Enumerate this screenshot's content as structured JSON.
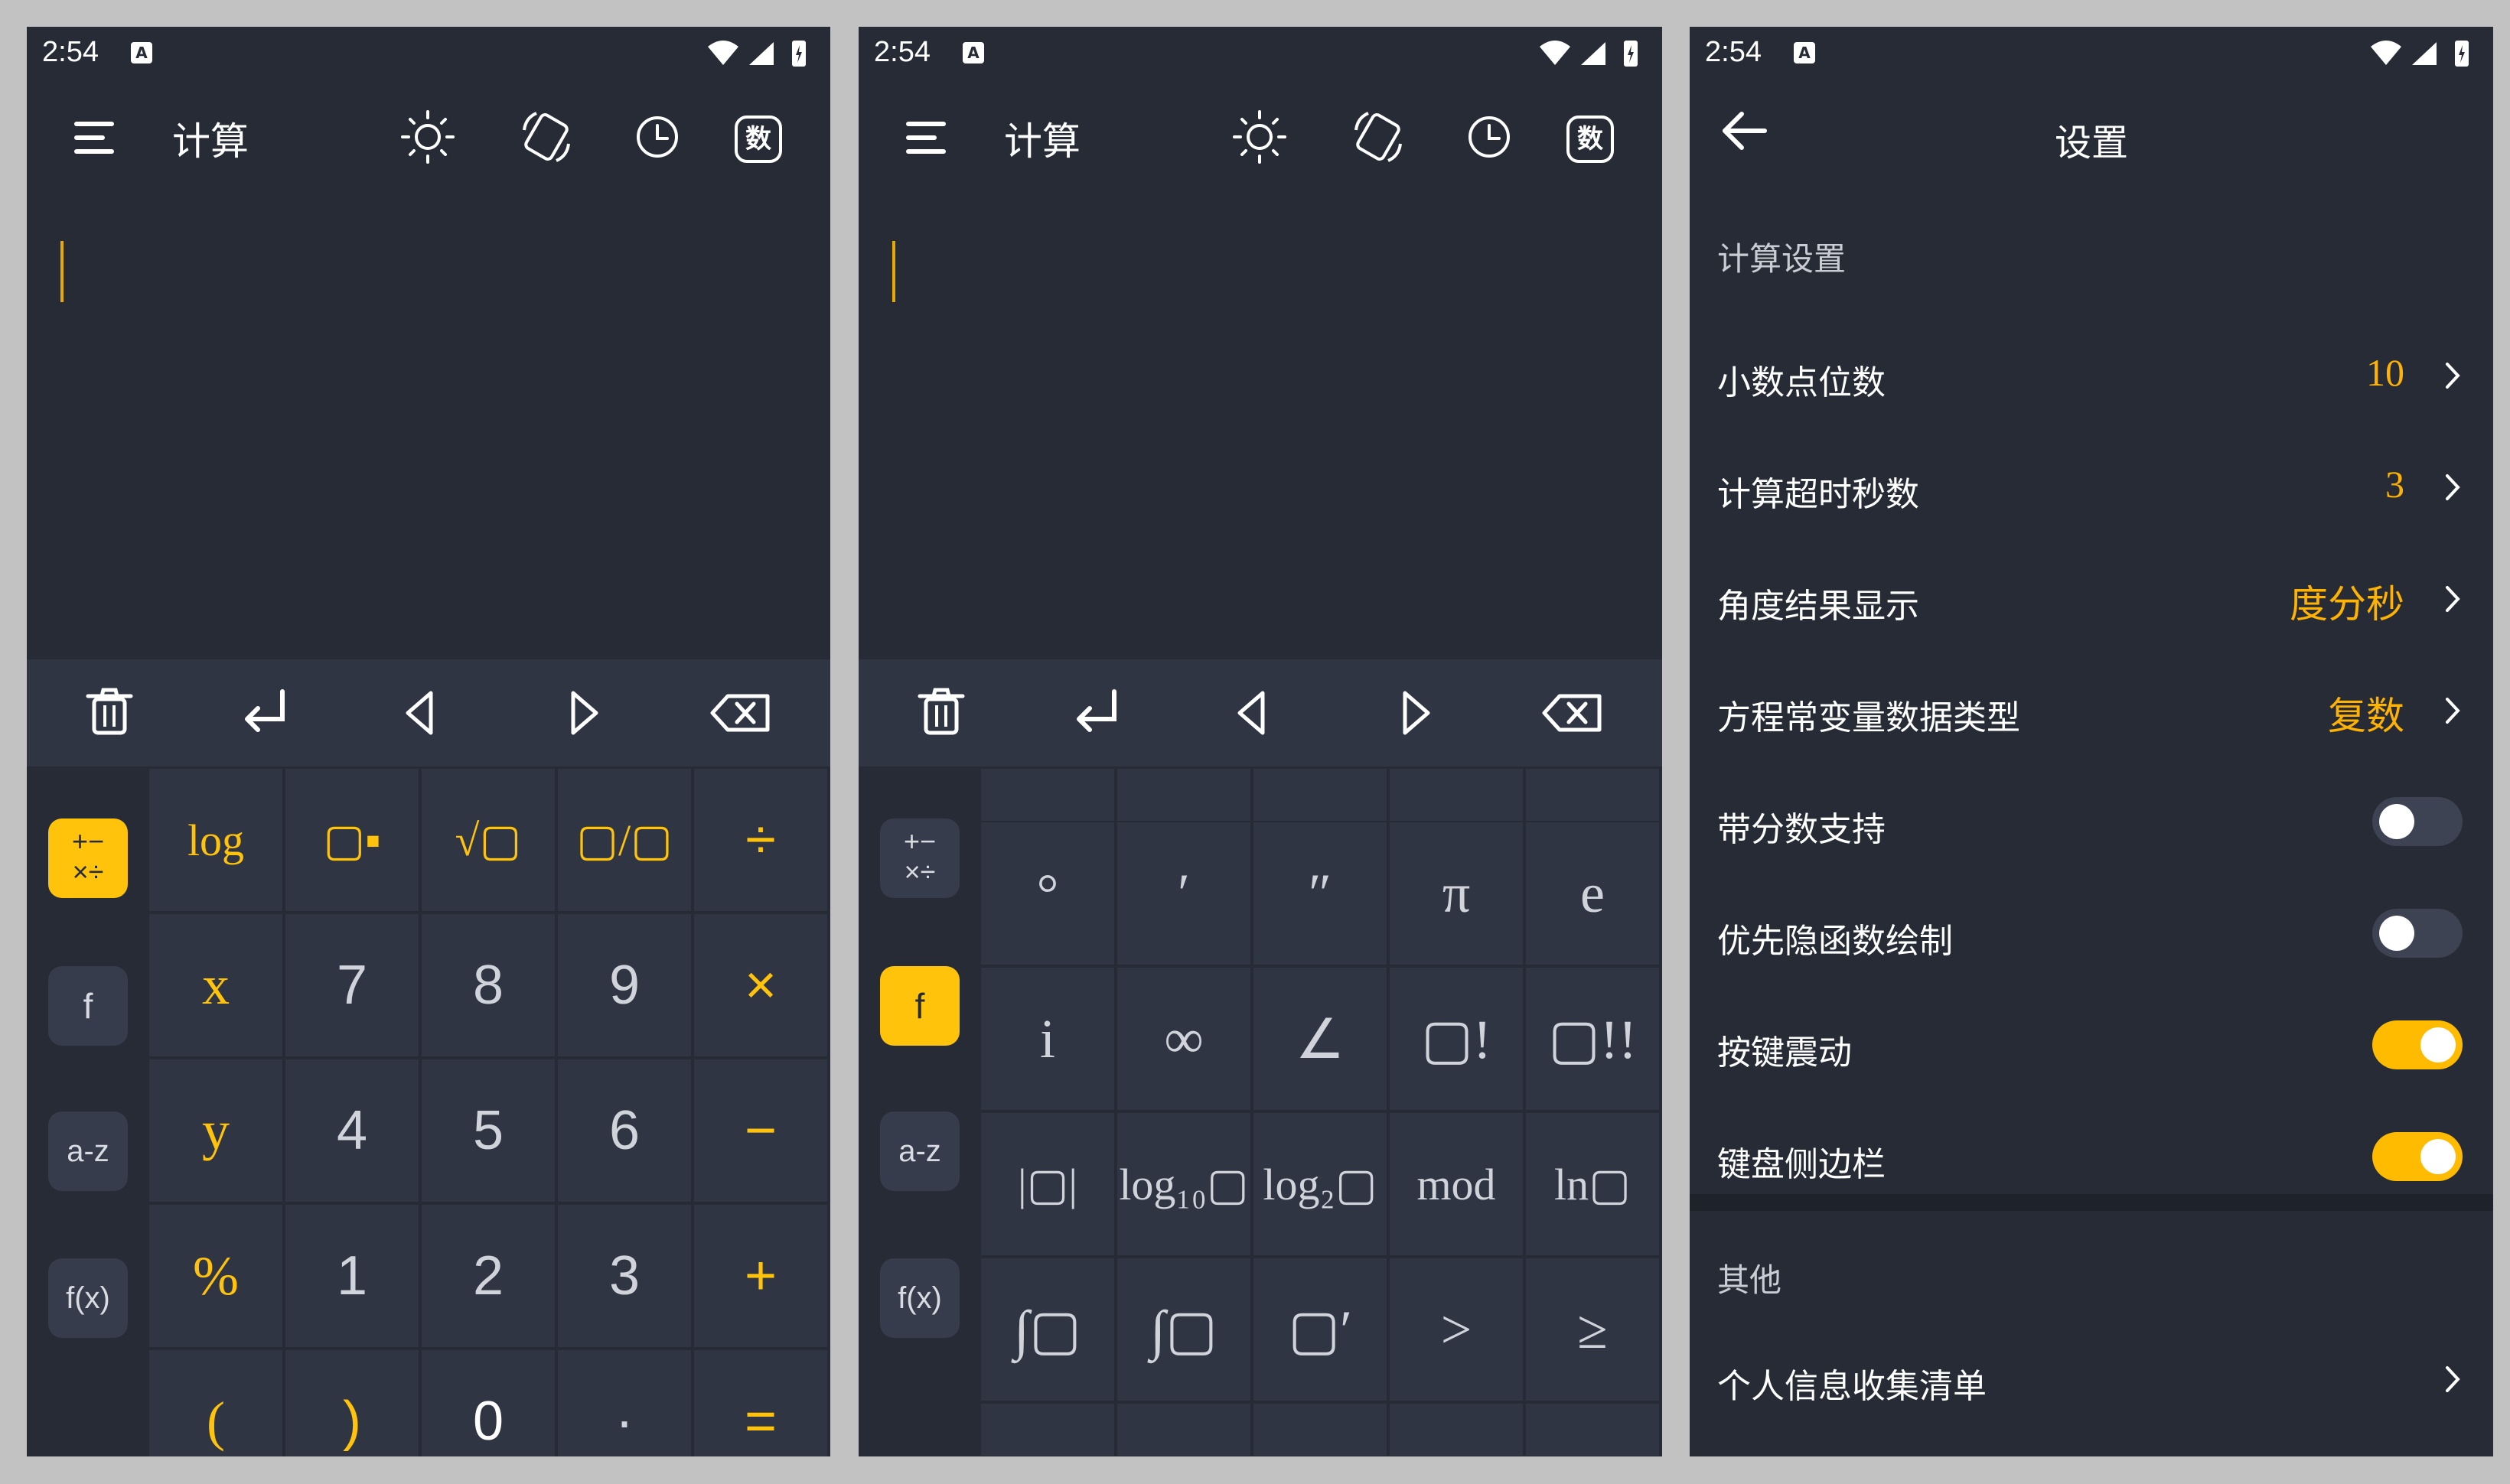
{
  "status": {
    "time": "2:54",
    "notif_glyph": "A"
  },
  "calc": {
    "title": "计算",
    "toolbar_icons": [
      "brightness-icon",
      "rotate-icon",
      "history-icon",
      "number-mode-icon"
    ],
    "toolbar_badge": "数",
    "nav_icons": [
      "trash-icon",
      "enter-icon",
      "cursor-left-icon",
      "cursor-right-icon",
      "backspace-icon"
    ],
    "sidebar": [
      "+−\n×÷",
      "f",
      "a-z",
      "f(x)"
    ],
    "keys_basic": [
      [
        "log",
        "▢▪",
        "√▢",
        "▢/▢",
        "÷"
      ],
      [
        "x",
        "7",
        "8",
        "9",
        "×"
      ],
      [
        "y",
        "4",
        "5",
        "6",
        "−"
      ],
      [
        "%",
        "1",
        "2",
        "3",
        "+"
      ],
      [
        "(",
        ")",
        "0",
        "·",
        "="
      ]
    ],
    "keys_func": [
      [
        "°",
        "′",
        "″",
        "π",
        "e"
      ],
      [
        "i",
        "∞",
        "∠",
        "▢!",
        "▢!!"
      ],
      [
        "|▢|",
        "log₁₀▢",
        "log₂▢",
        "mod",
        "ln▢"
      ],
      [
        "∫▢",
        "∫▢",
        "▢′",
        ">",
        "≥"
      ]
    ]
  },
  "settings": {
    "title": "设置",
    "section1": "计算设置",
    "rows": [
      {
        "label": "小数点位数",
        "value": "10",
        "type": "select"
      },
      {
        "label": "计算超时秒数",
        "value": "3",
        "type": "select"
      },
      {
        "label": "角度结果显示",
        "value": "度分秒",
        "type": "select"
      },
      {
        "label": "方程常变量数据类型",
        "value": "复数",
        "type": "select"
      },
      {
        "label": "带分数支持",
        "type": "toggle",
        "on": false
      },
      {
        "label": "优先隐函数绘制",
        "type": "toggle",
        "on": false
      },
      {
        "label": "按键震动",
        "type": "toggle",
        "on": true
      },
      {
        "label": "键盘侧边栏",
        "type": "toggle",
        "on": true
      }
    ],
    "section2": "其他",
    "other_rows": [
      {
        "label": "个人信息收集清单"
      }
    ]
  },
  "colors": {
    "accent": "#ffc30b",
    "bg": "#262b36",
    "key_bg": "#2f3543",
    "page_bg": "#c2c2c2"
  }
}
